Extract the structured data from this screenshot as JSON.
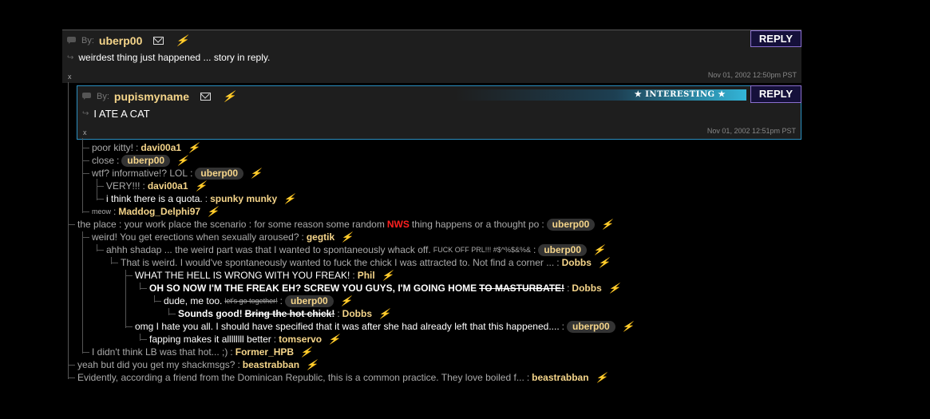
{
  "post1": {
    "by_label": "By:",
    "username": "uberp00",
    "body": "weirdest thing just happened ... story in reply.",
    "timestamp": "Nov 01, 2002 12:50pm PST",
    "reply_label": "REPLY",
    "x_label": "x"
  },
  "post2": {
    "by_label": "By:",
    "username": "pupismyname",
    "body": "I ATE A CAT",
    "timestamp": "Nov 01, 2002 12:51pm PST",
    "reply_label": "REPLY",
    "x_label": "x",
    "badge": "★ INTERESTING ★"
  },
  "replies": [
    {
      "text": "poor kitty!",
      "author": "davi00a1"
    },
    {
      "text": "close",
      "author": "uberp00"
    },
    {
      "text": "wtf? informative!? LOL",
      "author": "uberp00"
    },
    {
      "text": "VERY!!!",
      "author": "davi00a1"
    },
    {
      "text": "i think there is a quota.",
      "author": "spunky munky"
    },
    {
      "text": "meow",
      "author": "Maddog_Delphi97"
    },
    {
      "text": "the place : your work place the scenario : for some reason some random",
      "nws": "NWS",
      "text2": "thing happens or a thought po",
      "author": "uberp00"
    },
    {
      "text": "weird! You get erections when sexually aroused?",
      "author": "gegtik"
    },
    {
      "text": "ahhh shadap ... the weird part was that I wanted to spontaneously whack off.",
      "small": "FUCK OFF PRL!!! #$^%$&%&",
      "author": "uberp00"
    },
    {
      "text": "That is weird. I would've spontaneously wanted to fuck the chick I was attracted to. Not find a corner ...",
      "author": "Dobbs"
    },
    {
      "text": "WHAT THE HELL IS WRONG WITH YOU FREAK!",
      "author": "Phil"
    },
    {
      "text": "OH SO NOW I'M THE FREAK EH? SCREW YOU GUYS, I'M GOING HOME",
      "strike": "TO MASTURBATE!",
      "author": "Dobbs"
    },
    {
      "text": "dude, me too.",
      "small": "let's go together!",
      "author": "uberp00"
    },
    {
      "text": "Sounds good!",
      "strike": "Bring the hot chick!",
      "author": "Dobbs"
    },
    {
      "text": "omg I hate you all. I should have specified that it was after she had already left that this happened....",
      "author": "uberp00"
    },
    {
      "text": "fapping makes it allllllll better",
      "author": "tomservo"
    },
    {
      "text": "I didn't think LB was that hot... ;)",
      "author": "Former_HPB"
    },
    {
      "text": "yeah but did you get my shackmsgs?",
      "author": "beastrabban"
    },
    {
      "text": "Evidently, according a friend from the Dominican Republic, this is a common practice. They love boiled f...",
      "author": "beastrabban"
    }
  ],
  "separator": ":",
  "colors": {
    "background": "#000000",
    "post_bg": "#1e1e1e",
    "username": "#f5d58a",
    "lightning": "#e8c23a",
    "nws": "#ff2020",
    "highlight_border": "#2b8fc0",
    "reply_bg": "#15103a"
  }
}
